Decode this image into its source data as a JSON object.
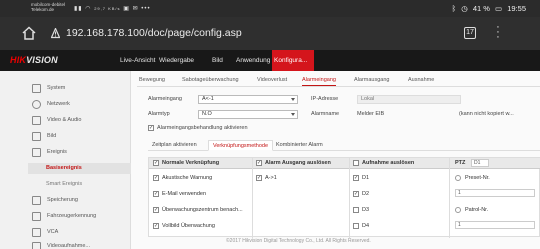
{
  "status_bar": {
    "carrier_line1": "mobilcom-debitel",
    "carrier_line2": "Telekom.de",
    "net": "29,7 KB/s",
    "battery": "41 %",
    "time": "19:55"
  },
  "browser": {
    "url": "192.168.178.100/doc/page/config.asp",
    "tab_count": "17"
  },
  "topnav": {
    "logo_hik": "HIK",
    "logo_rest": "VISION",
    "items": [
      "Live-Ansicht",
      "Wiedergabe",
      "Bild",
      "Anwendung",
      "Konfigura..."
    ]
  },
  "sidebar": {
    "items": [
      "System",
      "Netzwerk",
      "Video & Audio",
      "Bild",
      "Ereignis",
      "Speicherung",
      "Fahrzeugerkennung",
      "VCA",
      "Videoaufnahme..."
    ],
    "subitems": [
      "Basisereignis",
      "Smart Ereignis"
    ]
  },
  "subtabs": [
    "Bewegung",
    "Sabotageüberwachung",
    "Videoverlust",
    "Alarmeingang",
    "Alarmausgang",
    "Ausnahme"
  ],
  "form": {
    "alarmeingang_label": "Alarmeingang",
    "alarmeingang_value": "A<-1",
    "ip_label": "IP-Adresse",
    "ip_value": "Lokal",
    "alarmtyp_label": "Alarmtyp",
    "alarmtyp_value": "N.O",
    "alarmname_label": "Alarmname",
    "alarmname_value": "Melder EIB",
    "not_copyable": "(kann nicht kopiert w...",
    "enable_label": "Alarmeingangsbehandlung aktivieren"
  },
  "inner_tabs": [
    "Zeitplan aktivieren",
    "Verknüpfungsmethode",
    "Kombinierter Alarm"
  ],
  "grid": {
    "col1_header": "Normale Verknüpfung",
    "col2_header": "Alarm Ausgang auslösen",
    "col3_header": "Aufnahme auslösen",
    "col4_header": "PTZ",
    "ptz_select": "D1",
    "col1_items": [
      "Akustische Warnung",
      "E-Mail verwenden",
      "Überwachungszentrum benach...",
      "Vollbild Überwachung"
    ],
    "col2_items": [
      "A->1"
    ],
    "col3_items": [
      "D1",
      "D2",
      "D3",
      "D4"
    ],
    "col4_items": [
      "Preset-Nr.",
      "1",
      "Patrol-Nr.",
      "1"
    ]
  },
  "footer": "©2017 Hikvision Digital Technology Co., Ltd. All Rights Reserved."
}
